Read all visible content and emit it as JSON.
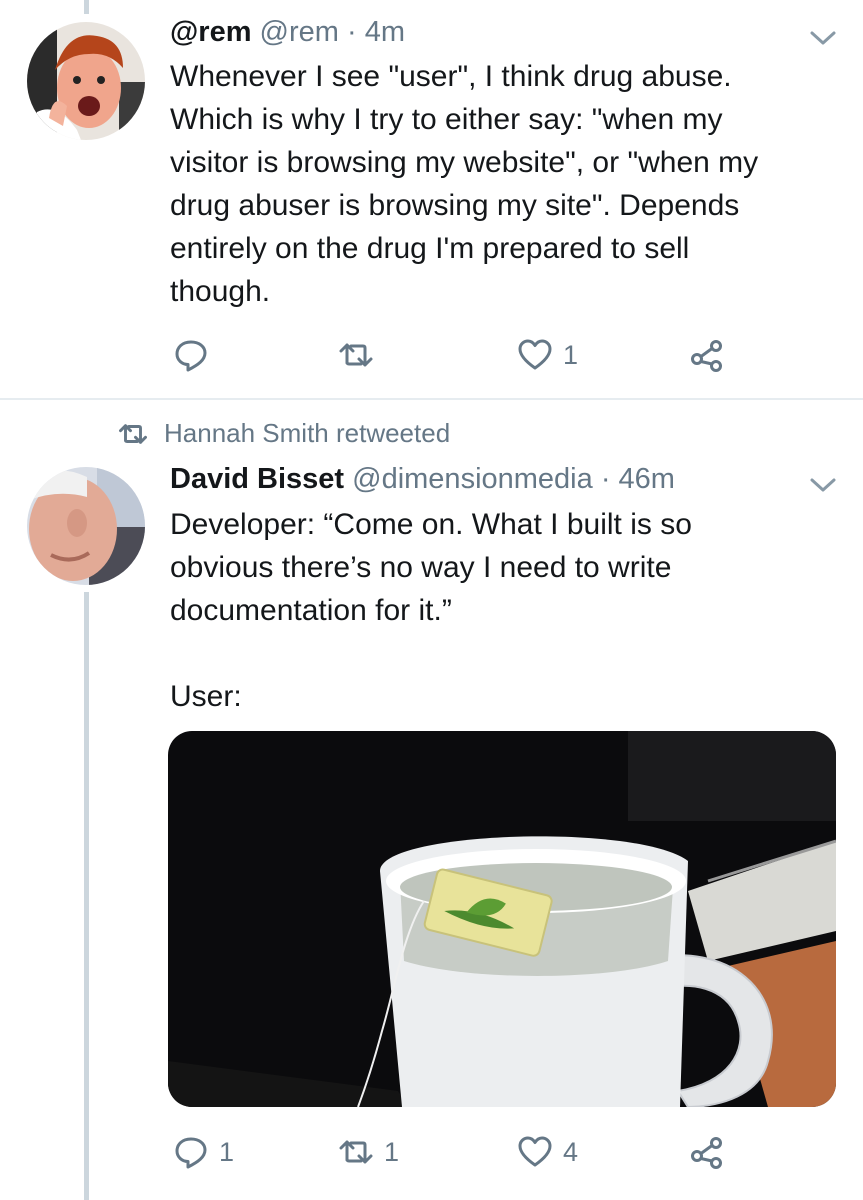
{
  "tweets": [
    {
      "name": "@rem",
      "handle": "@rem",
      "separator": "·",
      "time": "4m",
      "text": "Whenever I see \"user\", I think drug abuse.\nWhich is why I try to either say: \"when my\nvisitor is browsing my website\", or \"when my\ndrug abuser is browsing my site\". Depends\nentirely on the drug I'm prepared to sell\nthough.",
      "replies": "",
      "retweets": "",
      "likes": "1"
    },
    {
      "retweeted_by": "Hannah Smith retweeted",
      "name": "David Bisset",
      "handle": "@dimensionmedia",
      "separator": "·",
      "time": "46m",
      "text": "Developer: “Come on. What I built is so\nobvious there’s no way I need to write\ndocumentation for it.”\n\nUser:",
      "replies": "1",
      "retweets": "1",
      "likes": "4"
    }
  ],
  "icons": {
    "menu": "chevron-down-icon",
    "reply": "reply-icon",
    "retweet": "retweet-icon",
    "like": "heart-icon",
    "share": "share-icon"
  },
  "colors": {
    "text": "#14171a",
    "secondary": "#657786",
    "thread_line": "#ccd6dd",
    "divider": "#e6ecf0"
  }
}
